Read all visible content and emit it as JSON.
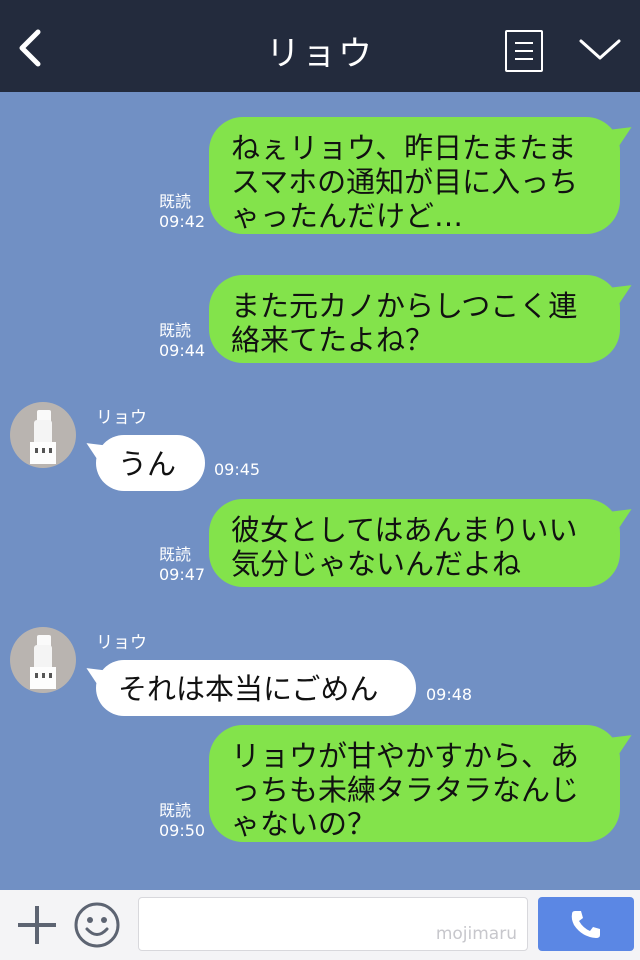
{
  "header": {
    "title": "リョウ"
  },
  "messages": [
    {
      "from": "me",
      "lines": [
        "ねぇリョウ、昨日たまたま",
        "スマホの通知が目に入っち",
        "ゃったんだけど…"
      ],
      "read": "既読",
      "time": "09:42"
    },
    {
      "from": "me",
      "lines": [
        "また元カノからしつこく連",
        "絡来てたよね？"
      ],
      "read": "既読",
      "time": "09:44"
    },
    {
      "from": "them",
      "name": "リョウ",
      "lines": [
        "うん"
      ],
      "time": "09:45"
    },
    {
      "from": "me",
      "lines": [
        "彼女としてはあんまりいい",
        "気分じゃないんだよね"
      ],
      "read": "既読",
      "time": "09:47"
    },
    {
      "from": "them",
      "name": "リョウ",
      "lines": [
        "それは本当にごめん"
      ],
      "time": "09:48"
    },
    {
      "from": "me",
      "lines": [
        "リョウが甘やかすから、あ",
        "っちも未練タラタラなんじ",
        "ゃないの？"
      ],
      "read": "既読",
      "time": "09:50"
    }
  ],
  "footer": {
    "watermark": "mojimaru"
  }
}
